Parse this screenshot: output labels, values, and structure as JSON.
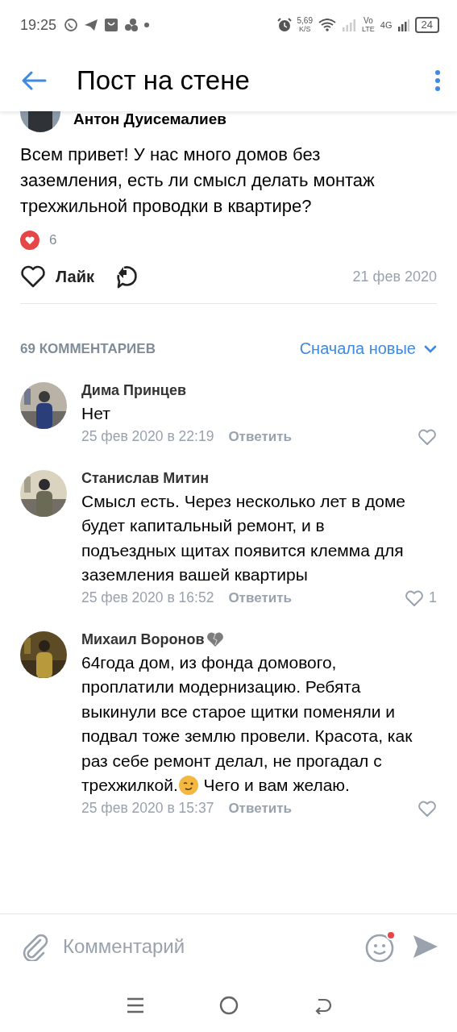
{
  "status_bar": {
    "time": "19:25",
    "speed": "5,69",
    "speed_unit": "K/S",
    "volte_top": "Vo",
    "volte_bottom": "LTE",
    "network": "4G",
    "battery": "24"
  },
  "header": {
    "title": "Пост на стене"
  },
  "post": {
    "author": "Антон Дуисемалиев",
    "text": "Всем привет! У нас много домов без заземления, есть ли смысл делать монтаж трехжильной проводки в квартире?",
    "reactions": "6",
    "like_label": "Лайк",
    "date": "21 фев 2020"
  },
  "comments_header": {
    "count": "69 КОММЕНТАРИЕВ",
    "sort": "Сначала новые"
  },
  "comments": [
    {
      "name": "Дима Принцев",
      "text": "Нет",
      "date": "25 фев 2020 в 22:19",
      "reply": "Ответить"
    },
    {
      "name": "Станислав Митин",
      "text": "Смысл есть. Через несколько лет в доме будет капитальный ремонт, и в подъездных щитах появится клемма для заземления вашей квартиры",
      "date": "25 фев 2020 в 16:52",
      "reply": "Ответить",
      "likes": "1"
    },
    {
      "name": "Михаил Воронов",
      "text": "64года дом, из фонда домового, проплатили модернизацию. Ребята выкинули все старое щитки поменяли и подвал тоже землю провели. Красота, как раз себе ремонт делал, не прогадал с трехжилкой.",
      "text_after": "Чего и вам желаю.",
      "date": "25 фев 2020 в 15:37",
      "reply": "Ответить"
    }
  ],
  "composer": {
    "placeholder": "Комментарий"
  }
}
